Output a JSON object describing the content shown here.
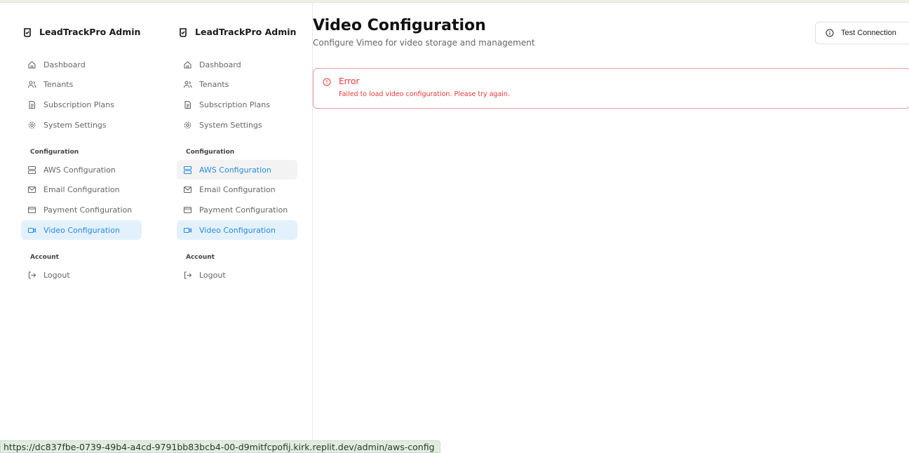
{
  "brand": {
    "name": "LeadTrackPro Admin",
    "icon": "shield-icon"
  },
  "sidebar_left": {
    "items": [
      {
        "label": "Dashboard",
        "icon": "home-icon"
      },
      {
        "label": "Tenants",
        "icon": "users-icon"
      },
      {
        "label": "Subscription Plans",
        "icon": "file-icon"
      },
      {
        "label": "System Settings",
        "icon": "gear-icon"
      }
    ],
    "config_label": "Configuration",
    "config_items": [
      {
        "label": "AWS Configuration",
        "icon": "server-icon"
      },
      {
        "label": "Email Configuration",
        "icon": "mail-icon"
      },
      {
        "label": "Payment Configuration",
        "icon": "credit-card-icon"
      },
      {
        "label": "Video Configuration",
        "icon": "video-icon",
        "active": true
      }
    ],
    "account_label": "Account",
    "account_items": [
      {
        "label": "Logout",
        "icon": "logout-icon"
      }
    ]
  },
  "sidebar_right": {
    "items": [
      {
        "label": "Dashboard"
      },
      {
        "label": "Tenants"
      },
      {
        "label": "Subscription Plans"
      },
      {
        "label": "System Settings"
      }
    ],
    "config_label": "Configuration",
    "config_items": [
      {
        "label": "AWS Configuration",
        "hover": true
      },
      {
        "label": "Email Configuration"
      },
      {
        "label": "Payment Configuration"
      },
      {
        "label": "Video Configuration",
        "active": true
      }
    ],
    "account_label": "Account",
    "account_items": [
      {
        "label": "Logout"
      }
    ]
  },
  "page": {
    "title": "Video Configuration",
    "subtitle": "Configure Vimeo for video storage and management",
    "test_button_label": "Test Connection"
  },
  "error": {
    "title": "Error",
    "message": "Failed to load video configuration. Please try again."
  },
  "status_bar": {
    "url": "https://dc837fbe-0739-49b4-a4cd-9791bb83bcb4-00-d9mitfcpofij.kirk.replit.dev/admin/aws-config"
  },
  "colors": {
    "accent": "#2a8bd8",
    "active_bg": "#e3f1fc",
    "error": "#e53935",
    "error_border": "#ef9a9a"
  }
}
